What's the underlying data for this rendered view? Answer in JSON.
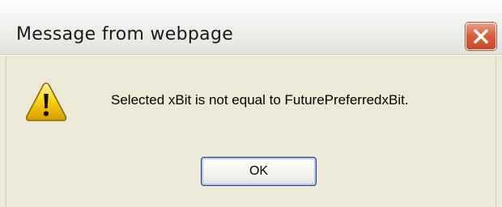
{
  "window": {
    "title": "Message from webpage"
  },
  "icons": {
    "message_icon": "warning-icon",
    "close_icon": "close-icon"
  },
  "message": {
    "text": "Selected xBit is not equal to FuturePreferredxBit."
  },
  "buttons": {
    "ok_label": "OK"
  },
  "colors": {
    "close_button": "#d9603d",
    "warning_yellow": "#f5d010",
    "dialog_background": "#ece9d8",
    "button_focus_border": "#1f3c86"
  }
}
